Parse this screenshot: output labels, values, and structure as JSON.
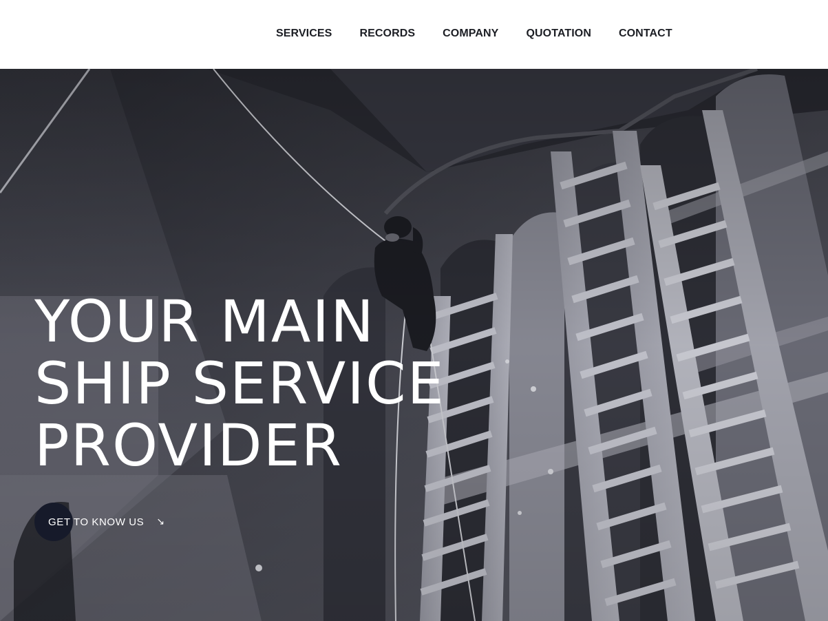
{
  "nav": {
    "items": [
      {
        "label": "SERVICES"
      },
      {
        "label": "RECORDS"
      },
      {
        "label": "COMPANY"
      },
      {
        "label": "QUOTATION"
      },
      {
        "label": "CONTACT"
      }
    ]
  },
  "hero": {
    "headline": [
      "YOUR MAIN",
      "SHIP SERVICE",
      "PROVIDER"
    ],
    "cta_label": "GET TO KNOW US",
    "cta_icon": "arrow-down-right-icon",
    "image_subject": "worker-on-ladder-in-ship-hull-photo"
  },
  "colors": {
    "nav_text": "#1c1e24",
    "cta_circle": "#161a2a",
    "hero_text": "#ffffff"
  }
}
